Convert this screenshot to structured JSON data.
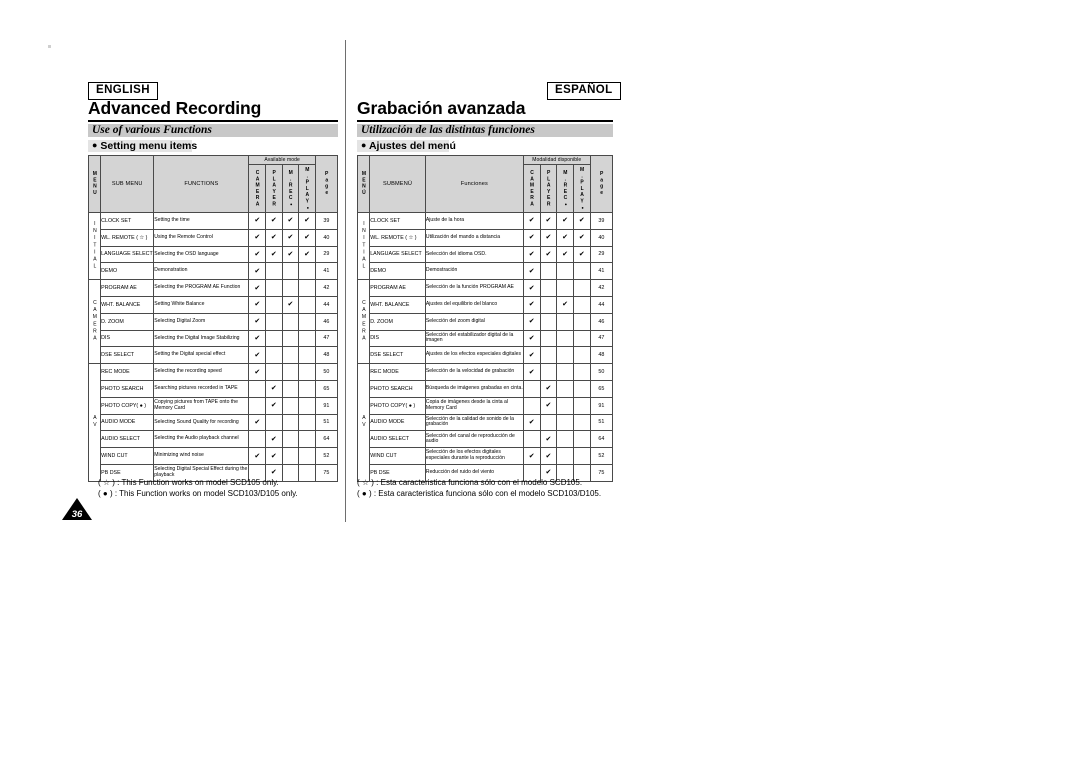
{
  "page": {
    "number": "36",
    "background": "#ffffff"
  },
  "english": {
    "lang_tag": "ENGLISH",
    "chapter_title": "Advanced Recording",
    "section_title": "Use of various Functions",
    "subsection_title": "Setting menu items",
    "table": {
      "headers": {
        "menu": "MENU",
        "sub_menu": "SUB MENU",
        "functions": "FUNCTIONS",
        "available_mode": "Available mode",
        "camera": "CAMERA",
        "player": "PLAYER",
        "mrec": "M.REC",
        "mplay": "M.PLAY",
        "mrec_sym": "●",
        "mplay_sym": "●",
        "page": "Page"
      },
      "check_symbol": "✔",
      "groups": [
        {
          "name": "INITIAL",
          "rows": [
            {
              "sub": "CLOCK SET",
              "fn": "Setting the time",
              "camera": true,
              "player": true,
              "mrec": true,
              "mplay": true,
              "page": "39"
            },
            {
              "sub": "WL. REMOTE ( ☆ )",
              "fn": "Using the Remote Control",
              "camera": true,
              "player": true,
              "mrec": true,
              "mplay": true,
              "page": "40"
            },
            {
              "sub": "LANGUAGE SELECT",
              "fn": "Selecting the OSD language",
              "camera": true,
              "player": true,
              "mrec": true,
              "mplay": true,
              "page": "29"
            },
            {
              "sub": "DEMO",
              "fn": "Demonstration",
              "camera": true,
              "player": false,
              "mrec": false,
              "mplay": false,
              "page": "41"
            }
          ]
        },
        {
          "name": "CAMERA",
          "rows": [
            {
              "sub": "PROGRAM AE",
              "fn": "Selecting the PROGRAM AE Function",
              "camera": true,
              "player": false,
              "mrec": false,
              "mplay": false,
              "page": "42"
            },
            {
              "sub": "WHT. BALANCE",
              "fn": "Setting White Balance",
              "camera": true,
              "player": false,
              "mrec": true,
              "mplay": false,
              "page": "44"
            },
            {
              "sub": "D. ZOOM",
              "fn": "Selecting Digital Zoom",
              "camera": true,
              "player": false,
              "mrec": false,
              "mplay": false,
              "page": "46"
            },
            {
              "sub": "DIS",
              "fn": "Selecting the Digital Image Stabilizing",
              "camera": true,
              "player": false,
              "mrec": false,
              "mplay": false,
              "page": "47"
            },
            {
              "sub": "DSE SELECT",
              "fn": "Setting the Digital special effect",
              "camera": true,
              "player": false,
              "mrec": false,
              "mplay": false,
              "page": "48"
            }
          ]
        },
        {
          "name": "A\nV",
          "rows": [
            {
              "sub": "REC MODE",
              "fn": "Selecting the recording speed",
              "camera": true,
              "player": false,
              "mrec": false,
              "mplay": false,
              "page": "50"
            },
            {
              "sub": "PHOTO SEARCH",
              "fn": "Searching pictures recorded in TAPE",
              "camera": false,
              "player": true,
              "mrec": false,
              "mplay": false,
              "page": "65"
            },
            {
              "sub": "PHOTO COPY( ● )",
              "fn": "Copying pictures from TAPE onto the Memory Card",
              "camera": false,
              "player": true,
              "mrec": false,
              "mplay": false,
              "page": "91"
            },
            {
              "sub": "AUDIO MODE",
              "fn": "Selecting Sound Quality for recording",
              "camera": true,
              "player": false,
              "mrec": false,
              "mplay": false,
              "page": "51"
            },
            {
              "sub": "AUDIO SELECT",
              "fn": "Selecting the Audio playback channel",
              "camera": false,
              "player": true,
              "mrec": false,
              "mplay": false,
              "page": "64"
            },
            {
              "sub": "WIND CUT",
              "fn": "Minimizing wind noise",
              "camera": true,
              "player": true,
              "mrec": false,
              "mplay": false,
              "page": "52"
            },
            {
              "sub": "PB DSE",
              "fn": "Selecting Digital Special Effect during the playback",
              "camera": false,
              "player": true,
              "mrec": false,
              "mplay": false,
              "page": "75"
            }
          ]
        }
      ]
    },
    "notes": [
      "( ☆ ) : This Function works on model SCD105 only.",
      "( ● ) : This Function works on model SCD103/D105 only."
    ]
  },
  "spanish": {
    "lang_tag": "ESPAÑOL",
    "chapter_title": "Grabación avanzada",
    "section_title": "Utilización de las distintas funciones",
    "subsection_title": "Ajustes del menú",
    "table": {
      "headers": {
        "menu": "MENÚ",
        "sub_menu": "SUBMENÚ",
        "functions": "Funciones",
        "available_mode": "Modalidad disponible",
        "camera": "CAMERA",
        "player": "PLAYER",
        "mrec": "M.REC",
        "mplay": "M.PLAY",
        "mrec_sym": "●",
        "mplay_sym": "●",
        "page": "Page"
      },
      "check_symbol": "✔",
      "groups": [
        {
          "name": "INITIAL",
          "rows": [
            {
              "sub": "CLOCK SET",
              "fn": "Ajuste de la hora",
              "camera": true,
              "player": true,
              "mrec": true,
              "mplay": true,
              "page": "39"
            },
            {
              "sub": "WL. REMOTE ( ☆ )",
              "fn": "Utilización del mando a distancia",
              "camera": true,
              "player": true,
              "mrec": true,
              "mplay": true,
              "page": "40"
            },
            {
              "sub": "LANGUAGE SELECT",
              "fn": "Selección del idioma OSD.",
              "camera": true,
              "player": true,
              "mrec": true,
              "mplay": true,
              "page": "29"
            },
            {
              "sub": "DEMO",
              "fn": "Demostración",
              "camera": true,
              "player": false,
              "mrec": false,
              "mplay": false,
              "page": "41"
            }
          ]
        },
        {
          "name": "CAMERA",
          "rows": [
            {
              "sub": "PROGRAM AE",
              "fn": "Selección de la función PROGRAM AE",
              "camera": true,
              "player": false,
              "mrec": false,
              "mplay": false,
              "page": "42"
            },
            {
              "sub": "WHT. BALANCE",
              "fn": "Ajustes del equilibrio del blanco",
              "camera": true,
              "player": false,
              "mrec": true,
              "mplay": false,
              "page": "44"
            },
            {
              "sub": "D. ZOOM",
              "fn": "Selección del zoom digital",
              "camera": true,
              "player": false,
              "mrec": false,
              "mplay": false,
              "page": "46"
            },
            {
              "sub": "DIS",
              "fn": "Selección del estabilizador digital de la imagen",
              "camera": true,
              "player": false,
              "mrec": false,
              "mplay": false,
              "page": "47"
            },
            {
              "sub": "DSE SELECT",
              "fn": "Ajustes de los efectos especiales digitales",
              "camera": true,
              "player": false,
              "mrec": false,
              "mplay": false,
              "page": "48"
            }
          ]
        },
        {
          "name": "A\nV",
          "rows": [
            {
              "sub": "REC MODE",
              "fn": "Selección de la velocidad de grabación",
              "camera": true,
              "player": false,
              "mrec": false,
              "mplay": false,
              "page": "50"
            },
            {
              "sub": "PHOTO SEARCH",
              "fn": "Búsqueda de imágenes grabadas en cinta.",
              "camera": false,
              "player": true,
              "mrec": false,
              "mplay": false,
              "page": "65"
            },
            {
              "sub": "PHOTO COPY( ● )",
              "fn": "Copia de imágenes desde la cinta al Memory Card",
              "camera": false,
              "player": true,
              "mrec": false,
              "mplay": false,
              "page": "91"
            },
            {
              "sub": "AUDIO MODE",
              "fn": "Selección de la calidad de sonido de la grabación",
              "camera": true,
              "player": false,
              "mrec": false,
              "mplay": false,
              "page": "51"
            },
            {
              "sub": "AUDIO SELECT",
              "fn": "Selección del canal de reproducción de audio",
              "camera": false,
              "player": true,
              "mrec": false,
              "mplay": false,
              "page": "64"
            },
            {
              "sub": "WIND CUT",
              "fn": "Selección de los efectos digitales especiales durante la reproducción",
              "camera": true,
              "player": true,
              "mrec": false,
              "mplay": false,
              "page": "52"
            },
            {
              "sub": "PB DSE",
              "fn": "Reducción del ruido del viento",
              "camera": false,
              "player": true,
              "mrec": false,
              "mplay": false,
              "page": "75"
            }
          ]
        }
      ]
    },
    "notes": [
      "( ☆ ) : Esta caracteristica funciona sólo con el modelo SCD105.",
      "( ● ) : Esta caracteristica funciona sólo con el modelo SCD103/D105."
    ]
  }
}
